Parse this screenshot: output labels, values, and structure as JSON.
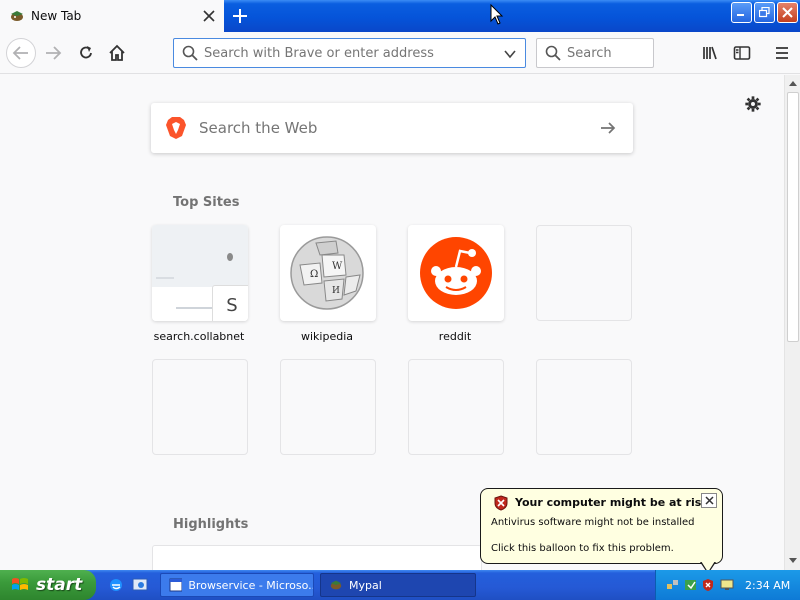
{
  "window": {
    "tab_title": "New Tab",
    "tab_icon": "mypal-icon",
    "new_tab_icon": "plus-icon",
    "controls": [
      "minimize",
      "restore",
      "close"
    ]
  },
  "toolbar": {
    "url_placeholder": "Search with Brave or enter address",
    "search_placeholder": "Search"
  },
  "content": {
    "web_search_placeholder": "Search the Web",
    "top_sites_title": "Top Sites",
    "highlights_title": "Highlights",
    "top_sites": [
      {
        "label": "search.collabnet",
        "badge": "S"
      },
      {
        "label": "wikipedia"
      },
      {
        "label": "reddit"
      },
      {
        "label": ""
      }
    ]
  },
  "balloon": {
    "title": "Your computer might be at risk",
    "line1": "Antivirus software might not be installed",
    "line2": "Click this balloon to fix this problem."
  },
  "taskbar": {
    "start_label": "start",
    "tasks": [
      {
        "label": "Browservice - Microso..."
      },
      {
        "label": "Mypal"
      }
    ],
    "clock": "2:34 AM"
  },
  "colors": {
    "xp_blue": "#0554d9",
    "start_green": "#3b9b3b",
    "reddit_orange": "#ff4500",
    "brave_orange": "#fb542b",
    "balloon_bg": "#ffffe1"
  }
}
